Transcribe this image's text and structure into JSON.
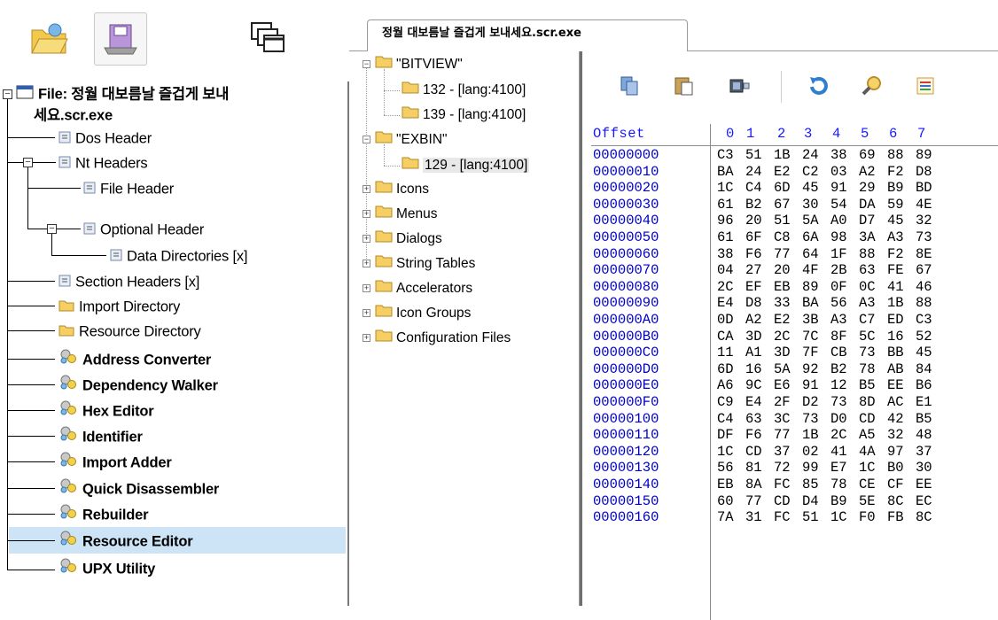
{
  "left_panel": {
    "toolbar": {
      "buttons": [
        {
          "name": "open-file-button",
          "icon": "open-folder-icon"
        },
        {
          "name": "save-file-button",
          "icon": "save-disk-icon"
        },
        {
          "name": "windows-button",
          "icon": "cascade-windows-icon"
        }
      ]
    },
    "tree": {
      "root_label": "File: 정월 대보름날 즐겁게 보내",
      "root_label_cont": "세요.scr.exe",
      "items": [
        {
          "label": "Dos Header"
        },
        {
          "label": "Nt Headers"
        },
        {
          "label": "File Header"
        },
        {
          "label": "Optional Header"
        },
        {
          "label": "Data Directories [x]"
        },
        {
          "label": "Section Headers [x]"
        },
        {
          "label": "Import Directory"
        },
        {
          "label": "Resource Directory"
        },
        {
          "label": "Address Converter"
        },
        {
          "label": "Dependency Walker"
        },
        {
          "label": "Hex Editor"
        },
        {
          "label": "Identifier"
        },
        {
          "label": "Import Adder"
        },
        {
          "label": "Quick Disassembler"
        },
        {
          "label": "Rebuilder"
        },
        {
          "label": "Resource Editor"
        },
        {
          "label": "UPX Utility"
        }
      ],
      "selected": "Resource Editor"
    }
  },
  "tab": {
    "label": "정월 대보름날 즐겁게 보내세요.scr.exe"
  },
  "resource_tree": {
    "items": [
      {
        "label": "\"BITVIEW\""
      },
      {
        "label": "132 - [lang:4100]"
      },
      {
        "label": "139 - [lang:4100]"
      },
      {
        "label": "\"EXBIN\""
      },
      {
        "label": "129 - [lang:4100]"
      },
      {
        "label": "Icons"
      },
      {
        "label": "Menus"
      },
      {
        "label": "Dialogs"
      },
      {
        "label": "String Tables"
      },
      {
        "label": "Accelerators"
      },
      {
        "label": "Icon Groups"
      },
      {
        "label": "Configuration Files"
      }
    ],
    "selected": "129 - [lang:4100]"
  },
  "hex_editor": {
    "toolbar_icons": [
      "copy-icon",
      "paste-icon",
      "export-icon",
      "refresh-icon",
      "search-icon",
      "list-icon"
    ],
    "header": {
      "offset_label": "Offset",
      "columns": [
        "0",
        "1",
        "2",
        "3",
        "4",
        "5",
        "6",
        "7"
      ]
    },
    "rows": [
      {
        "addr": "00000000",
        "bytes": [
          "C3",
          "51",
          "1B",
          "24",
          "38",
          "69",
          "88",
          "89"
        ]
      },
      {
        "addr": "00000010",
        "bytes": [
          "BA",
          "24",
          "E2",
          "C2",
          "03",
          "A2",
          "F2",
          "D8"
        ]
      },
      {
        "addr": "00000020",
        "bytes": [
          "1C",
          "C4",
          "6D",
          "45",
          "91",
          "29",
          "B9",
          "BD"
        ]
      },
      {
        "addr": "00000030",
        "bytes": [
          "61",
          "B2",
          "67",
          "30",
          "54",
          "DA",
          "59",
          "4E"
        ]
      },
      {
        "addr": "00000040",
        "bytes": [
          "96",
          "20",
          "51",
          "5A",
          "A0",
          "D7",
          "45",
          "32"
        ]
      },
      {
        "addr": "00000050",
        "bytes": [
          "61",
          "6F",
          "C8",
          "6A",
          "98",
          "3A",
          "A3",
          "73"
        ]
      },
      {
        "addr": "00000060",
        "bytes": [
          "38",
          "F6",
          "77",
          "64",
          "1F",
          "88",
          "F2",
          "8E"
        ]
      },
      {
        "addr": "00000070",
        "bytes": [
          "04",
          "27",
          "20",
          "4F",
          "2B",
          "63",
          "FE",
          "67"
        ]
      },
      {
        "addr": "00000080",
        "bytes": [
          "2C",
          "EF",
          "EB",
          "89",
          "0F",
          "0C",
          "41",
          "46"
        ]
      },
      {
        "addr": "00000090",
        "bytes": [
          "E4",
          "D8",
          "33",
          "BA",
          "56",
          "A3",
          "1B",
          "88"
        ]
      },
      {
        "addr": "000000A0",
        "bytes": [
          "0D",
          "A2",
          "E2",
          "3B",
          "A3",
          "C7",
          "ED",
          "C3"
        ]
      },
      {
        "addr": "000000B0",
        "bytes": [
          "CA",
          "3D",
          "2C",
          "7C",
          "8F",
          "5C",
          "16",
          "52"
        ]
      },
      {
        "addr": "000000C0",
        "bytes": [
          "11",
          "A1",
          "3D",
          "7F",
          "CB",
          "73",
          "BB",
          "45"
        ]
      },
      {
        "addr": "000000D0",
        "bytes": [
          "6D",
          "16",
          "5A",
          "92",
          "B2",
          "78",
          "AB",
          "84"
        ]
      },
      {
        "addr": "000000E0",
        "bytes": [
          "A6",
          "9C",
          "E6",
          "91",
          "12",
          "B5",
          "EE",
          "B6"
        ]
      },
      {
        "addr": "000000F0",
        "bytes": [
          "C9",
          "E4",
          "2F",
          "D2",
          "73",
          "8D",
          "AC",
          "E1"
        ]
      },
      {
        "addr": "00000100",
        "bytes": [
          "C4",
          "63",
          "3C",
          "73",
          "D0",
          "CD",
          "42",
          "B5"
        ]
      },
      {
        "addr": "00000110",
        "bytes": [
          "DF",
          "F6",
          "77",
          "1B",
          "2C",
          "A5",
          "32",
          "48"
        ]
      },
      {
        "addr": "00000120",
        "bytes": [
          "1C",
          "CD",
          "37",
          "02",
          "41",
          "4A",
          "97",
          "37"
        ]
      },
      {
        "addr": "00000130",
        "bytes": [
          "56",
          "81",
          "72",
          "99",
          "E7",
          "1C",
          "B0",
          "30"
        ]
      },
      {
        "addr": "00000140",
        "bytes": [
          "EB",
          "8A",
          "FC",
          "85",
          "78",
          "CE",
          "CF",
          "EE"
        ]
      },
      {
        "addr": "00000150",
        "bytes": [
          "60",
          "77",
          "CD",
          "D4",
          "B9",
          "5E",
          "8C",
          "EC"
        ]
      },
      {
        "addr": "00000160",
        "bytes": [
          "7A",
          "31",
          "FC",
          "51",
          "1C",
          "F0",
          "FB",
          "8C"
        ]
      }
    ]
  },
  "colors": {
    "selection": "#cde4f7",
    "offset_blue": "#0000cc",
    "header_blue": "#1919ff"
  }
}
